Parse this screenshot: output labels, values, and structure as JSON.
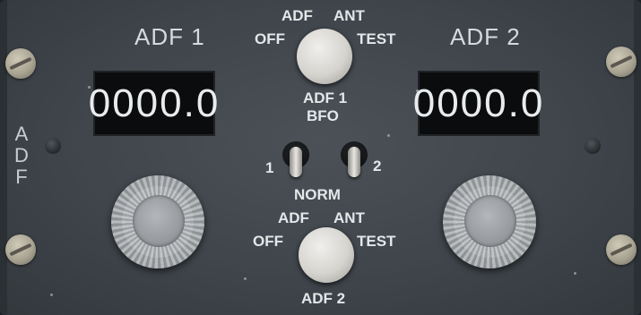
{
  "panel": {
    "side_label_letters": [
      "A",
      "D",
      "F"
    ],
    "adf1": {
      "title": "ADF 1",
      "frequency": "0000.0"
    },
    "adf2": {
      "title": "ADF 2",
      "frequency": "0000.0"
    },
    "mode_selector_1": {
      "options": {
        "off": "OFF",
        "adf": "ADF",
        "ant": "ANT",
        "test": "TEST"
      },
      "caption_line1": "ADF 1",
      "caption_line2": "BFO"
    },
    "bfo_switches": {
      "left_label": "1",
      "right_label": "2",
      "center_label": "NORM"
    },
    "mode_selector_2": {
      "options": {
        "off": "OFF",
        "adf": "ADF",
        "ant": "ANT",
        "test": "TEST"
      },
      "caption": "ADF 2"
    }
  }
}
